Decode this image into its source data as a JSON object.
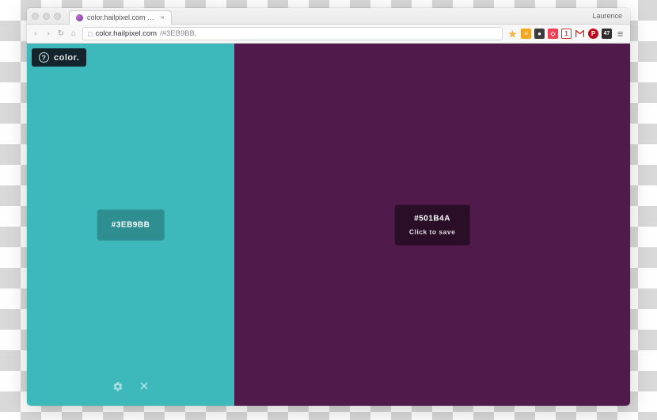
{
  "browser": {
    "tab_title": "color.hailpixel.com - Swatc",
    "profile": "Laurence",
    "url_host": "color.hailpixel.com",
    "url_path": "/#3EB9BB,",
    "ext_count": "47"
  },
  "logo": {
    "text": "color."
  },
  "swatches": {
    "left": {
      "hex": "#3EB9BB",
      "bg": "#3EB9BB"
    },
    "right": {
      "hex": "#501B4A",
      "bg": "#501B4A",
      "hint": "Click to save"
    }
  }
}
